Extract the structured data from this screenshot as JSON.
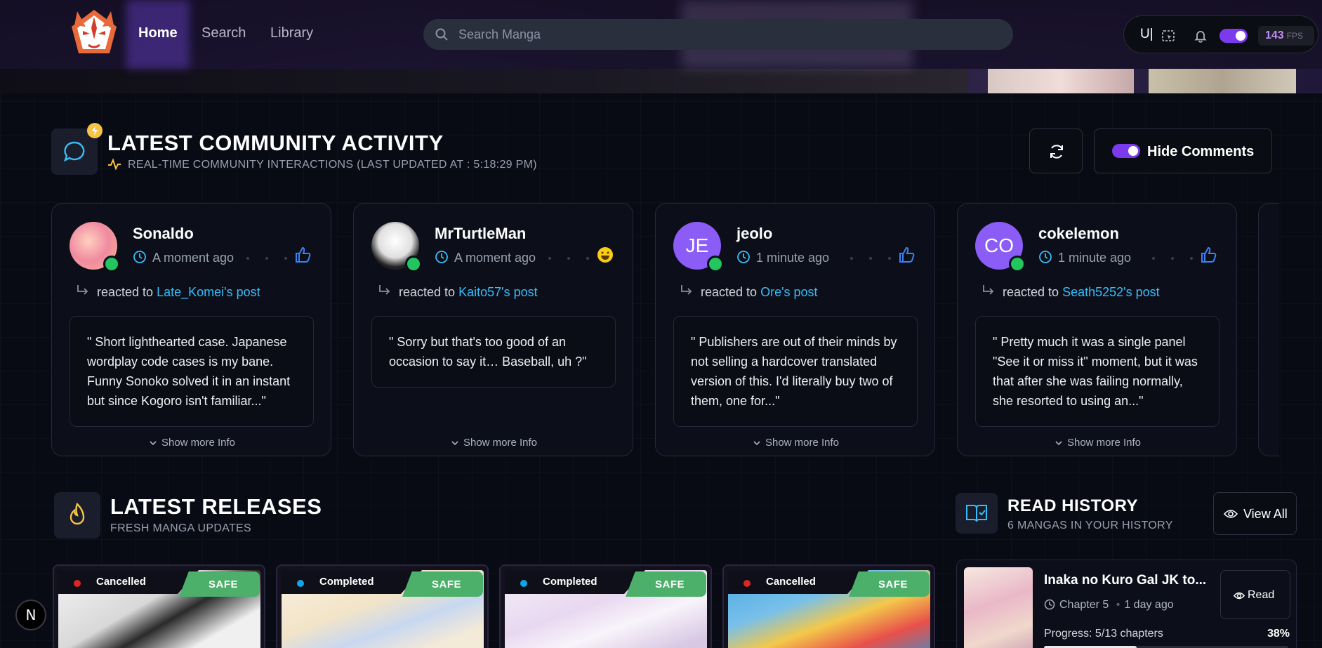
{
  "nav": {
    "home": "Home",
    "search": "Search",
    "library": "Library"
  },
  "search": {
    "placeholder": "Search Manga"
  },
  "toolbar": {
    "u_label": "U|",
    "fps_value": "143",
    "fps_unit": "FPS"
  },
  "community": {
    "title": "LATEST COMMUNITY ACTIVITY",
    "subtitle": "REAL-TIME COMMUNITY INTERACTIONS (LAST UPDATED AT : 5:18:29 PM)",
    "hide_comments_label": "Hide Comments",
    "cards": [
      {
        "user": "Sonaldo",
        "time": "A moment ago",
        "reacted": "reacted to",
        "target": "Late_Komei's post",
        "quote": "\" Short lighthearted case. Japanese wordplay code cases is my bane. Funny Sonoko solved it in an instant but since Kogoro isn't familiar...\"",
        "more": "Show more Info",
        "reaction": "thumbs-up"
      },
      {
        "user": "MrTurtleMan",
        "time": "A moment ago",
        "reacted": "reacted to",
        "target": "Kaito57's post",
        "quote": "\" Sorry but that's too good of an occasion to say it… Baseball, uh ?\"",
        "more": "Show more Info",
        "reaction": "laugh"
      },
      {
        "user": "jeolo",
        "initials": "JE",
        "time": "1 minute ago",
        "reacted": "reacted to",
        "target": "Ore's post",
        "quote": "\" Publishers are out of their minds by not selling a hardcover translated version of this. I'd literally buy two of them, one for...\"",
        "more": "Show more Info",
        "reaction": "thumbs-up"
      },
      {
        "user": "cokelemon",
        "initials": "CO",
        "time": "1 minute ago",
        "reacted": "reacted to",
        "target": "Seath5252's post",
        "quote": "\" Pretty much it was a single panel \"See it or miss it\" moment, but it was that after she was failing normally, she resorted to using an...\"",
        "more": "Show more Info",
        "reaction": "thumbs-up"
      }
    ]
  },
  "releases": {
    "title": "LATEST RELEASES",
    "subtitle": "FRESH MANGA UPDATES",
    "items": [
      {
        "status": "Cancelled",
        "rating": "SAFE",
        "status_color": "#dc2626"
      },
      {
        "status": "Completed",
        "rating": "SAFE",
        "status_color": "#0ea5e9"
      },
      {
        "status": "Completed",
        "rating": "SAFE",
        "status_color": "#0ea5e9"
      },
      {
        "status": "Cancelled",
        "rating": "SAFE",
        "status_color": "#dc2626"
      }
    ]
  },
  "history": {
    "title": "READ HISTORY",
    "subtitle": "6 MANGAS IN YOUR HISTORY",
    "view_all": "View All",
    "item": {
      "title": "Inaka no Kuro Gal JK to...",
      "chapter": "Chapter 5",
      "ago": "1 day ago",
      "read_label": "Read",
      "progress_label": "Progress: 5/13 chapters",
      "percent": "38%",
      "progress": 0.38
    }
  },
  "colors": {
    "accent": "#7c3aed",
    "link": "#38bdf8",
    "online": "#22c55e",
    "safe": "#4caf6a"
  },
  "badge": {
    "label": "N"
  }
}
